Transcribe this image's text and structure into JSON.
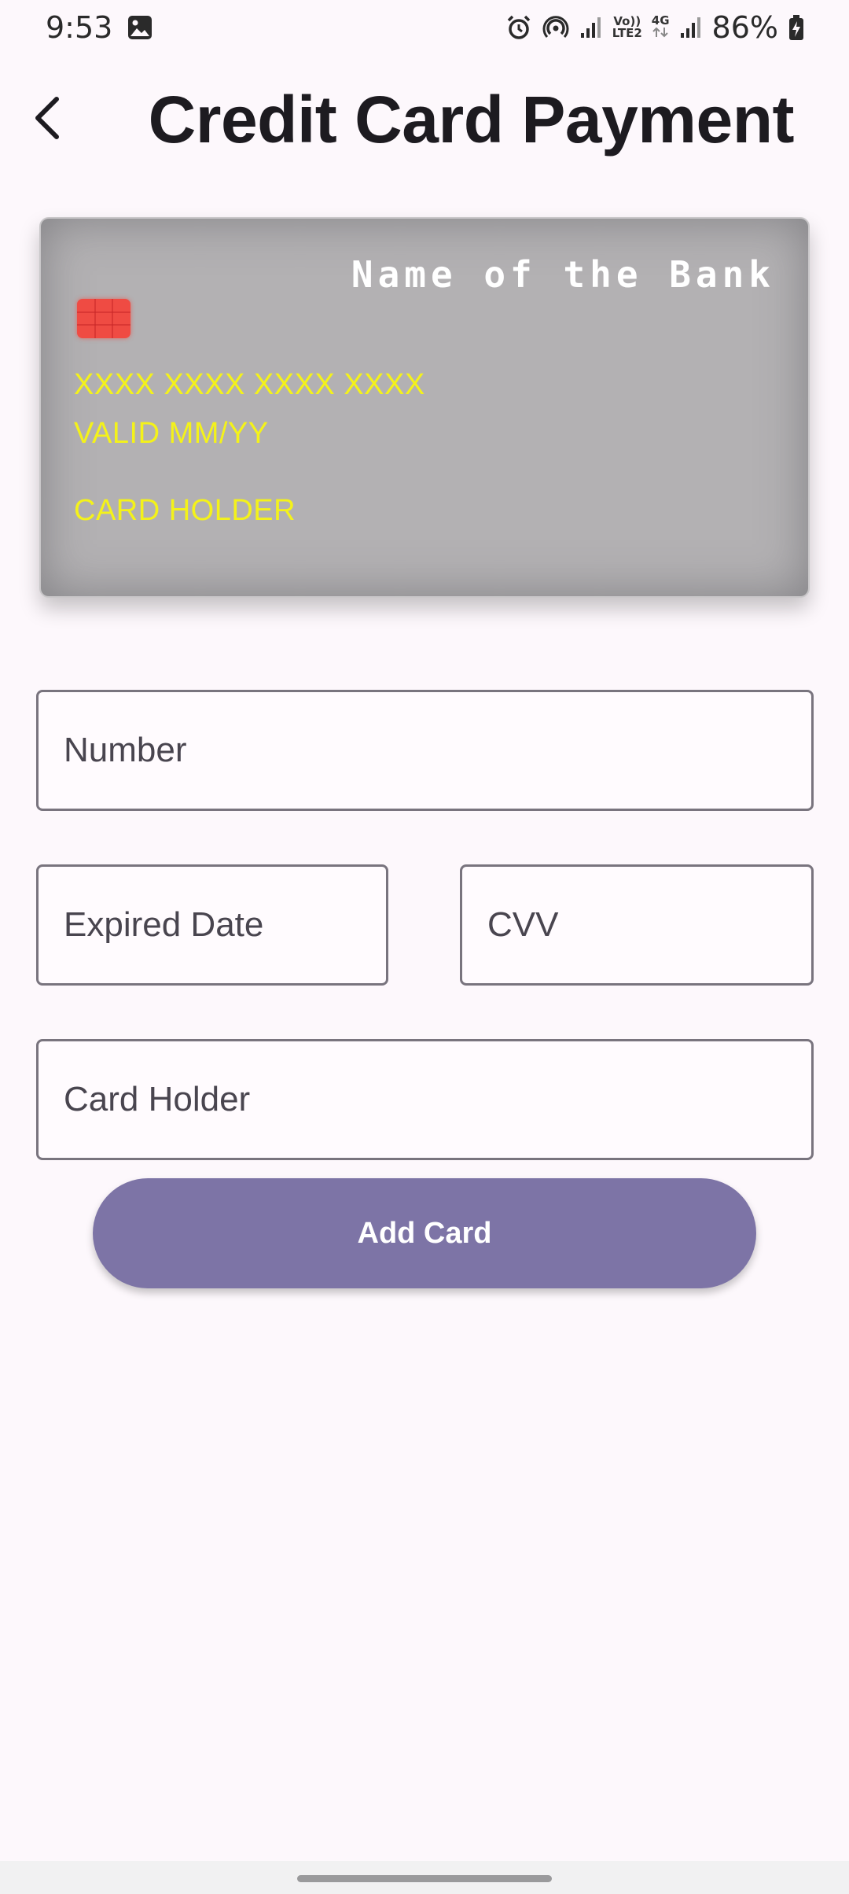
{
  "status_bar": {
    "time": "9:53",
    "battery": "86%",
    "volte_label_top": "Vo))",
    "volte_label_bottom": "LTE2",
    "network_label": "4G",
    "icons": [
      "gallery-icon",
      "alarm-icon",
      "hotspot-icon",
      "signal-icon",
      "volte-icon",
      "data-arrows-icon",
      "signal-icon",
      "battery-charging-icon"
    ]
  },
  "app_bar": {
    "title": "Credit Card Payment",
    "back_icon": "chevron-left-icon"
  },
  "card_preview": {
    "bank_name": "Name of the Bank",
    "number": "XXXX XXXX XXXX XXXX",
    "valid": "VALID MM/YY",
    "holder": "CARD HOLDER",
    "colors": {
      "card_background": "#b3b1b3",
      "card_text": "#f4f21a",
      "bank_text": "#ffffff",
      "chip": "#ef4b43"
    }
  },
  "form": {
    "number": {
      "value": "",
      "placeholder": "Number"
    },
    "expiry": {
      "value": "",
      "placeholder": "Expired Date"
    },
    "cvv": {
      "value": "",
      "placeholder": "CVV"
    },
    "holder": {
      "value": "",
      "placeholder": "Card Holder"
    }
  },
  "actions": {
    "add_card_label": "Add Card",
    "button_color": "#7d74a6"
  }
}
